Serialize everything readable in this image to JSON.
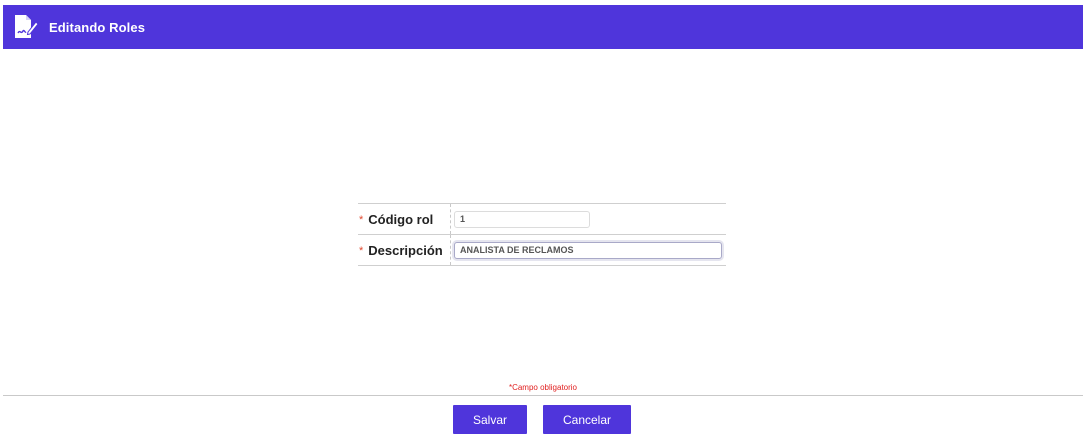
{
  "header": {
    "title": "Editando Roles",
    "icon": "edit-document-icon",
    "background": "#4f35db"
  },
  "form": {
    "fields": [
      {
        "required_mark": "*",
        "label": "Código rol",
        "value": "1"
      },
      {
        "required_mark": "*",
        "label": "Descripción",
        "value": "ANALISTA DE RECLAMOS"
      }
    ]
  },
  "footer": {
    "required_note": "*Campo obligatorio",
    "save_label": "Salvar",
    "cancel_label": "Cancelar"
  },
  "colors": {
    "accent": "#4f35db",
    "required": "#e12020"
  }
}
